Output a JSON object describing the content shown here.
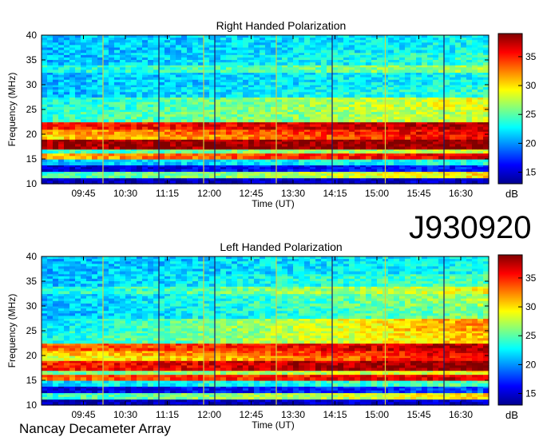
{
  "observation_id": "J930920",
  "instrument": "Nancay Decameter Array",
  "colors": {
    "colormap": [
      "#00008f",
      "#0000ff",
      "#0080ff",
      "#00ffff",
      "#80ff80",
      "#ffff00",
      "#ff8000",
      "#ff0000",
      "#800000"
    ]
  },
  "chart_data": [
    {
      "type": "heatmap",
      "title": "Right Handed Polarization",
      "xlabel": "Time (UT)",
      "ylabel": "Frequency (MHz)",
      "x_ticks": [
        "09:45",
        "10:30",
        "11:15",
        "12:00",
        "12:45",
        "13:30",
        "14:15",
        "15:00",
        "15:45",
        "16:30"
      ],
      "x_range_hours": [
        9.0,
        17.0
      ],
      "y_ticks": [
        10,
        15,
        20,
        25,
        30,
        35,
        40
      ],
      "ylim": [
        10,
        40
      ],
      "colorbar": {
        "label": "dB",
        "ticks": [
          15,
          20,
          25,
          30,
          35
        ],
        "range": [
          13,
          39
        ]
      },
      "bands": [
        {
          "f": [
            10,
            11.2
          ],
          "v0": 14,
          "v1": 15
        },
        {
          "f": [
            11.2,
            12.5
          ],
          "v0": 24,
          "v1": 30
        },
        {
          "f": [
            12.5,
            13.8
          ],
          "v0": 15,
          "v1": 17
        },
        {
          "f": [
            13.8,
            15.0
          ],
          "v0": 21,
          "v1": 24
        },
        {
          "f": [
            15.0,
            16.2
          ],
          "v0": 31,
          "v1": 37
        },
        {
          "f": [
            16.2,
            17.0
          ],
          "v0": 24,
          "v1": 28
        },
        {
          "f": [
            17.0,
            19.0
          ],
          "v0": 38,
          "v1": 39
        },
        {
          "f": [
            19.0,
            20.0
          ],
          "v0": 30,
          "v1": 36
        },
        {
          "f": [
            20.0,
            21.0
          ],
          "v0": 31,
          "v1": 37
        },
        {
          "f": [
            21.0,
            22.5
          ],
          "v0": 35,
          "v1": 38
        },
        {
          "f": [
            22.5,
            25.0
          ],
          "v0": 24,
          "v1": 28
        },
        {
          "f": [
            25.0,
            27.5
          ],
          "v0": 23,
          "v1": 29
        },
        {
          "f": [
            27.5,
            30.0
          ],
          "v0": 21,
          "v1": 24
        },
        {
          "f": [
            30.0,
            32.5
          ],
          "v0": 21,
          "v1": 23
        },
        {
          "f": [
            32.5,
            34.0
          ],
          "v0": 23,
          "v1": 27
        },
        {
          "f": [
            34.0,
            36.5
          ],
          "v0": 21,
          "v1": 24
        },
        {
          "f": [
            36.5,
            40.0
          ],
          "v0": 21,
          "v1": 23
        }
      ],
      "interference_lines_hours": [
        10.1,
        11.1,
        11.9,
        12.1,
        13.2,
        14.2,
        15.15,
        16.2
      ]
    },
    {
      "type": "heatmap",
      "title": "Left Handed Polarization",
      "xlabel": "Time (UT)",
      "ylabel": "Frequency (MHz)",
      "x_ticks": [
        "09:45",
        "10:30",
        "11:15",
        "12:00",
        "12:45",
        "13:30",
        "14:15",
        "15:00",
        "15:45",
        "16:30"
      ],
      "x_range_hours": [
        9.0,
        17.0
      ],
      "y_ticks": [
        10,
        15,
        20,
        25,
        30,
        35,
        40
      ],
      "ylim": [
        10,
        40
      ],
      "colorbar": {
        "label": "dB",
        "ticks": [
          15,
          20,
          25,
          30,
          35
        ],
        "range": [
          13,
          39
        ]
      },
      "bands": [
        {
          "f": [
            10,
            11.2
          ],
          "v0": 14,
          "v1": 15
        },
        {
          "f": [
            11.2,
            12.5
          ],
          "v0": 24,
          "v1": 30
        },
        {
          "f": [
            12.5,
            13.8
          ],
          "v0": 15,
          "v1": 18
        },
        {
          "f": [
            13.8,
            15.0
          ],
          "v0": 22,
          "v1": 25
        },
        {
          "f": [
            15.0,
            16.2
          ],
          "v0": 33,
          "v1": 37
        },
        {
          "f": [
            16.2,
            17.0
          ],
          "v0": 25,
          "v1": 29
        },
        {
          "f": [
            17.0,
            19.0
          ],
          "v0": 35,
          "v1": 39
        },
        {
          "f": [
            19.0,
            20.0
          ],
          "v0": 28,
          "v1": 36
        },
        {
          "f": [
            20.0,
            21.0
          ],
          "v0": 30,
          "v1": 37
        },
        {
          "f": [
            21.0,
            22.5
          ],
          "v0": 33,
          "v1": 38
        },
        {
          "f": [
            22.5,
            25.0
          ],
          "v0": 23,
          "v1": 31
        },
        {
          "f": [
            25.0,
            27.5
          ],
          "v0": 22,
          "v1": 32
        },
        {
          "f": [
            27.5,
            30.0
          ],
          "v0": 21,
          "v1": 26
        },
        {
          "f": [
            30.0,
            32.5
          ],
          "v0": 21,
          "v1": 27
        },
        {
          "f": [
            32.5,
            34.0
          ],
          "v0": 23,
          "v1": 29
        },
        {
          "f": [
            34.0,
            36.5
          ],
          "v0": 21,
          "v1": 25
        },
        {
          "f": [
            36.5,
            40.0
          ],
          "v0": 21,
          "v1": 23
        }
      ],
      "interference_lines_hours": [
        10.1,
        11.1,
        11.9,
        12.1,
        13.2,
        14.2,
        15.15,
        16.2
      ]
    }
  ]
}
